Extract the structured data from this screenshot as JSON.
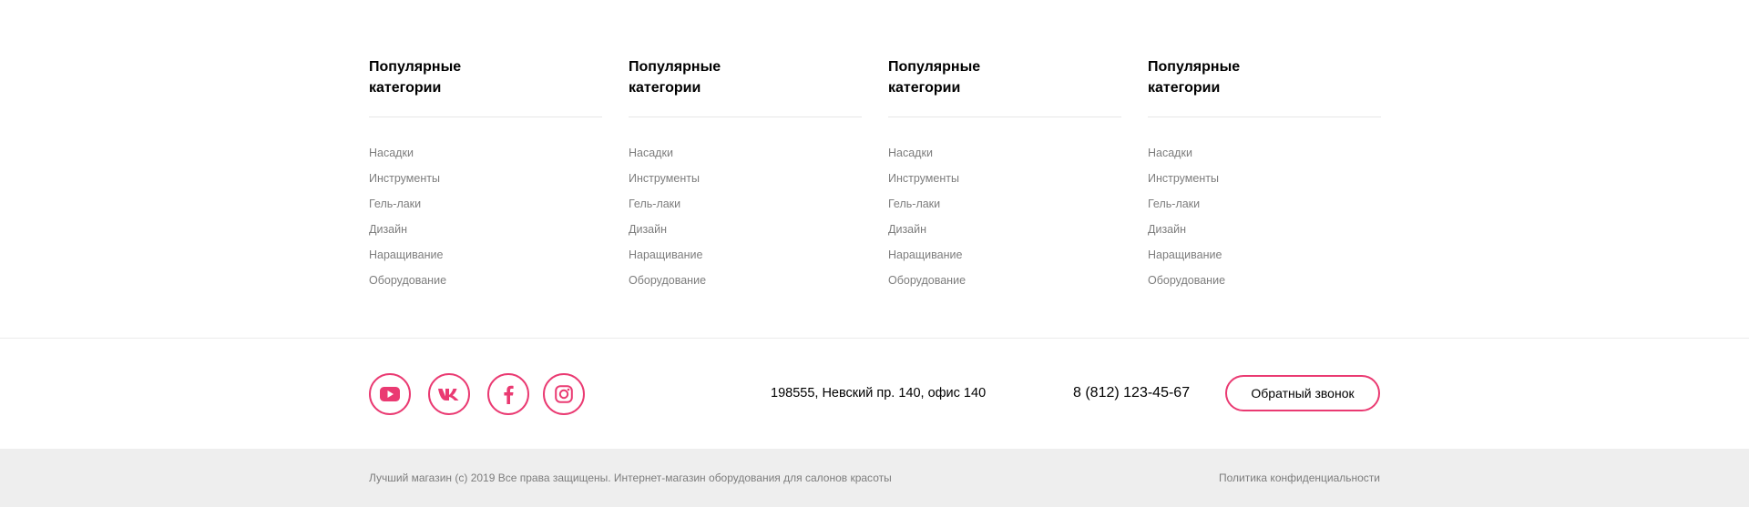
{
  "columns": [
    {
      "title": "Популярные категории",
      "items": [
        "Насадки",
        "Инструменты",
        "Гель-лаки",
        "Дизайн",
        "Наращивание",
        "Оборудование"
      ]
    },
    {
      "title": "Популярные категории",
      "items": [
        "Насадки",
        "Инструменты",
        "Гель-лаки",
        "Дизайн",
        "Наращивание",
        "Оборудование"
      ]
    },
    {
      "title": "Популярные категории",
      "items": [
        "Насадки",
        "Инструменты",
        "Гель-лаки",
        "Дизайн",
        "Наращивание",
        "Оборудование"
      ]
    },
    {
      "title": "Популярные категории",
      "items": [
        "Насадки",
        "Инструменты",
        "Гель-лаки",
        "Дизайн",
        "Наращивание",
        "Оборудование"
      ]
    }
  ],
  "social": [
    {
      "icon": "youtube-icon"
    },
    {
      "icon": "vk-icon"
    },
    {
      "icon": "facebook-icon"
    },
    {
      "icon": "instagram-icon"
    }
  ],
  "contacts": {
    "address": "198555, Невский пр. 140, офис 140",
    "phone": "8 (812) 123-45-67",
    "callback_label": "Обратный звонок"
  },
  "bottom": {
    "copyright": "Лучший магазин (c) 2019 Все права защищены. Интернет-магазин оборудования для салонов красоты",
    "privacy": "Политика конфиденциальности"
  },
  "colors": {
    "accent": "#ea3a72",
    "muted_text": "#7d7d7d",
    "bottom_bar": "#eeeeee"
  }
}
